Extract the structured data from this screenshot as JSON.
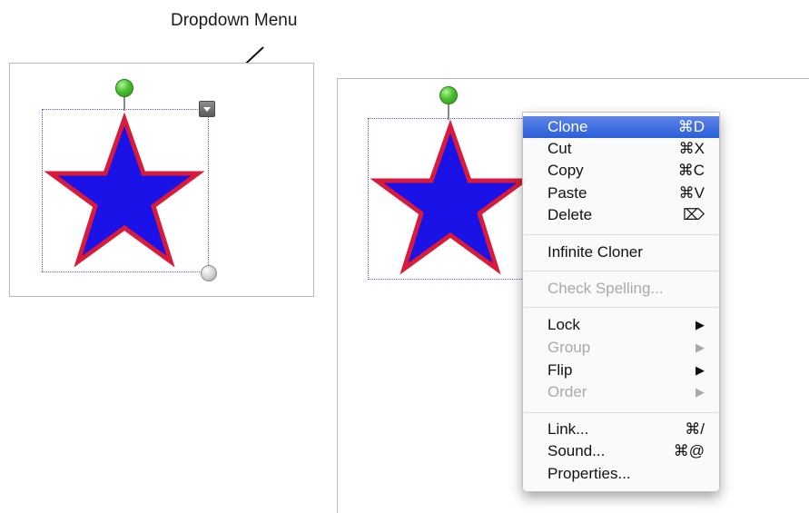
{
  "callout": {
    "text": "Dropdown Menu"
  },
  "shape": {
    "fill": "#1a12e6",
    "stroke": "#d81b3a"
  },
  "context_menu": {
    "items": [
      {
        "label": "Clone",
        "shortcut": "⌘D",
        "highlighted": true
      },
      {
        "label": "Cut",
        "shortcut": "⌘X"
      },
      {
        "label": "Copy",
        "shortcut": "⌘C"
      },
      {
        "label": "Paste",
        "shortcut": "⌘V"
      },
      {
        "label": "Delete",
        "shortcut": "⌦"
      },
      {
        "label": "Infinite Cloner"
      },
      {
        "label": "Check Spelling...",
        "disabled": true
      },
      {
        "label": "Lock",
        "submenu": "▶"
      },
      {
        "label": "Group",
        "submenu": "▶",
        "disabled": true
      },
      {
        "label": "Flip",
        "submenu": "▶"
      },
      {
        "label": "Order",
        "submenu": "▶",
        "disabled": true
      },
      {
        "label": "Link...",
        "shortcut": "⌘/"
      },
      {
        "label": "Sound...",
        "shortcut": "⌘@"
      },
      {
        "label": "Properties..."
      }
    ]
  },
  "icons": [
    "rotate-handle-icon",
    "resize-handle-icon",
    "dropdown-arrow-icon",
    "star-shape-icon",
    "submenu-arrow-icon"
  ],
  "colors": {
    "menu_highlight": "#2b5ed9",
    "rotate_handle": "#47c22e",
    "selection_border": "#5b5bd6"
  }
}
